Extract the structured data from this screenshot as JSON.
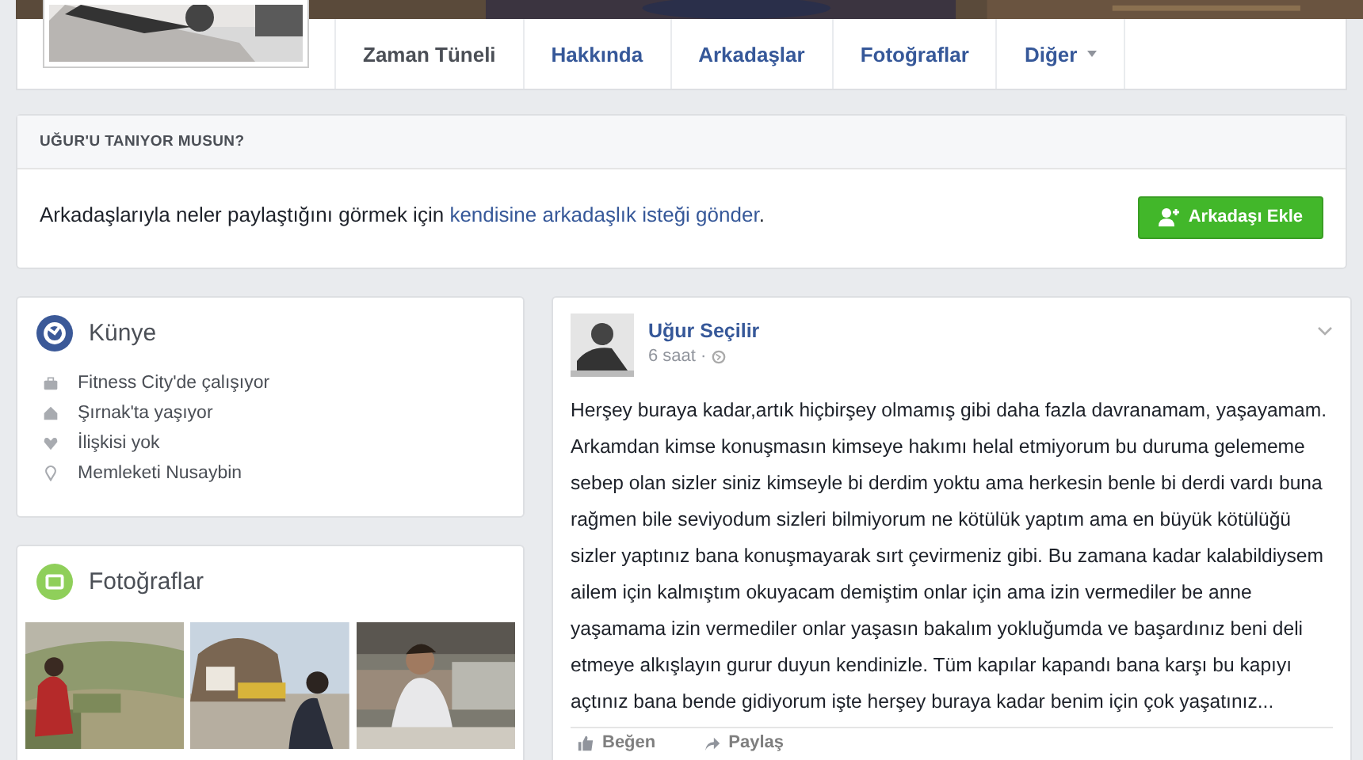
{
  "profile": {
    "tabs": [
      {
        "label": "Zaman Tüneli",
        "selected": true,
        "kind": "plain"
      },
      {
        "label": "Hakkında",
        "selected": false,
        "kind": "plain"
      },
      {
        "label": "Arkadaşlar",
        "selected": false,
        "kind": "plain"
      },
      {
        "label": "Fotoğraflar",
        "selected": false,
        "kind": "plain"
      },
      {
        "label": "Diğer",
        "selected": false,
        "kind": "menu"
      }
    ]
  },
  "friend_prompt": {
    "title": "UĞUR'U TANIYOR MUSUN?",
    "message": "Arkadaşlarıyla neler paylaştığını görmek için ",
    "link": "kendisine arkadaşlık isteği gönder",
    "suffix": ".",
    "button": "Arkadaşı Ekle"
  },
  "intro": {
    "title": "Künye",
    "items": [
      {
        "kind": "work",
        "text": "Fitness City'de çalışıyor"
      },
      {
        "kind": "home",
        "text": "Şırnak'ta yaşıyor"
      },
      {
        "kind": "relationship",
        "text": "İlişkisi yok"
      },
      {
        "kind": "hometown",
        "text": "Memleketi Nusaybin"
      }
    ]
  },
  "photos": {
    "title": "Fotoğraflar"
  },
  "post": {
    "author": "Uğur Seçilir",
    "time": "6 saat ·",
    "text": "Herşey buraya kadar,artık hiçbirşey olmamış gibi daha fazla davranamam, yaşayamam. Arkamdan kimse konuşmasın kimseye hakımı helal etmiyorum bu duruma gelememe sebep olan sizler siniz kimseyle bi derdim yoktu ama herkesin benle bi derdi vardı buna rağmen bile seviyodum sizleri bilmiyorum ne kötülük yaptım ama en büyük kötülüğü sizler yaptınız bana konuşmayarak sırt çevirmeniz gibi. Bu zamana kadar kalabildiysem ailem için kalmıştım okuyacam demiştim onlar için ama izin vermediler be anne yaşamama izin vermediler onlar yaşasın bakalım yokluğumda ve başardınız beni deli etmeye alkışlayın gurur duyun kendinizle. Tüm kapılar kapandı bana karşı bu kapıyı açtınız bana bende gidiyorum işte herşey buraya kadar benim için çok yaşatınız...",
    "actions": [
      {
        "kind": "like",
        "label": "Beğen"
      },
      {
        "kind": "share",
        "label": "Paylaş"
      }
    ]
  }
}
